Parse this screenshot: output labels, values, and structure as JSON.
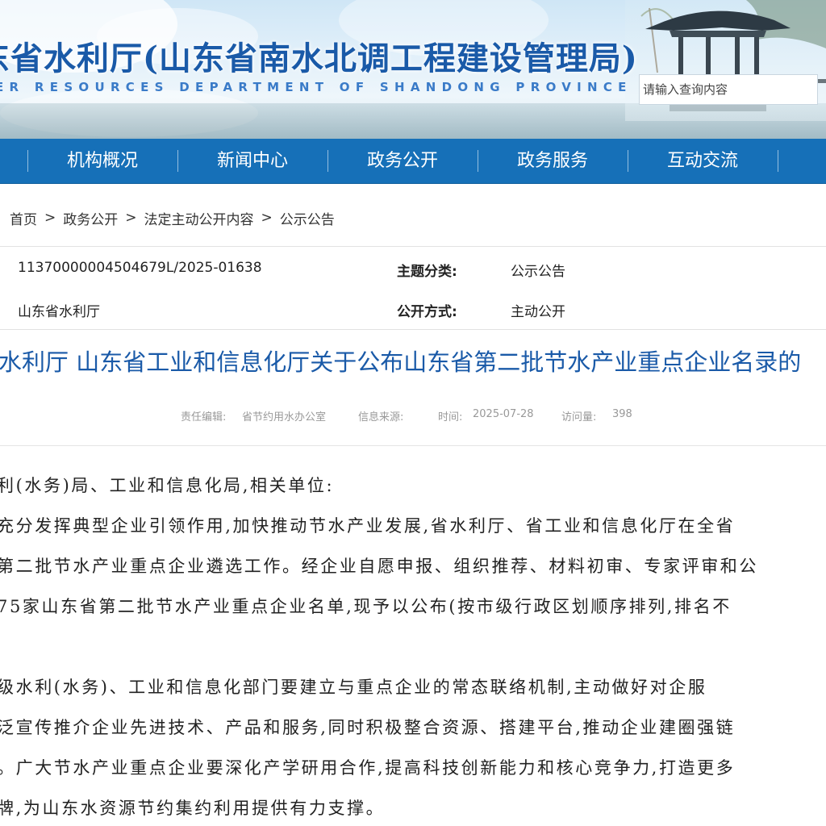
{
  "header": {
    "title": "东省水利厅(山东省南水北调工程建设管理局)",
    "subtitle": "ER RESOURCES DEPARTMENT OF SHANDONG PROVINCE",
    "search_placeholder": "请输入查询内容"
  },
  "nav": {
    "items": [
      "机构概况",
      "新闻中心",
      "政务公开",
      "政务服务",
      "互动交流"
    ]
  },
  "breadcrumb": {
    "items": [
      "首页",
      "政务公开",
      "法定主动公开内容",
      "公示公告"
    ],
    "separator": ">"
  },
  "info": {
    "index_no": "11370000004504679L/2025-01638",
    "publisher": "山东省水利厅",
    "topic_label": "主题分类:",
    "topic_value": "公示公告",
    "method_label": "公开方式:",
    "method_value": "主动公开"
  },
  "article": {
    "title": "水利厅 山东省工业和信息化厅关于公布山东省第二批节水产业重点企业名录的",
    "meta": {
      "editor_label": "责任编辑:",
      "editor_value": "省节约用水办公室",
      "source_label": "信息来源:",
      "time_label": "时间:",
      "time_value": "2025-07-28",
      "views_label": "访问量:",
      "views_value": "398"
    },
    "lines": [
      "利(水务)局、工业和信息化局,相关单位:",
      "充分发挥典型企业引领作用,加快推动节水产业发展,省水利厅、省工业和信息化厅在全省",
      "第二批节水产业重点企业遴选工作。经企业自愿申报、组织推荐、材料初审、专家评审和公",
      "75家山东省第二批节水产业重点企业名单,现予以公布(按市级行政区划顺序排列,排名不",
      "级水利(水务)、工业和信息化部门要建立与重点企业的常态联络机制,主动做好对企服",
      "泛宣传推介企业先进技术、产品和服务,同时积极整合资源、搭建平台,推动企业建圈强链",
      "。广大节水产业重点企业要深化产学研用合作,提高科技创新能力和核心竞争力,打造更多",
      "牌,为山东水资源节约集约利用提供有力支撑。"
    ]
  },
  "colors": {
    "nav_bg": "#1670b8",
    "title_blue": "#1a5aa8",
    "meta_gray": "#999999"
  }
}
